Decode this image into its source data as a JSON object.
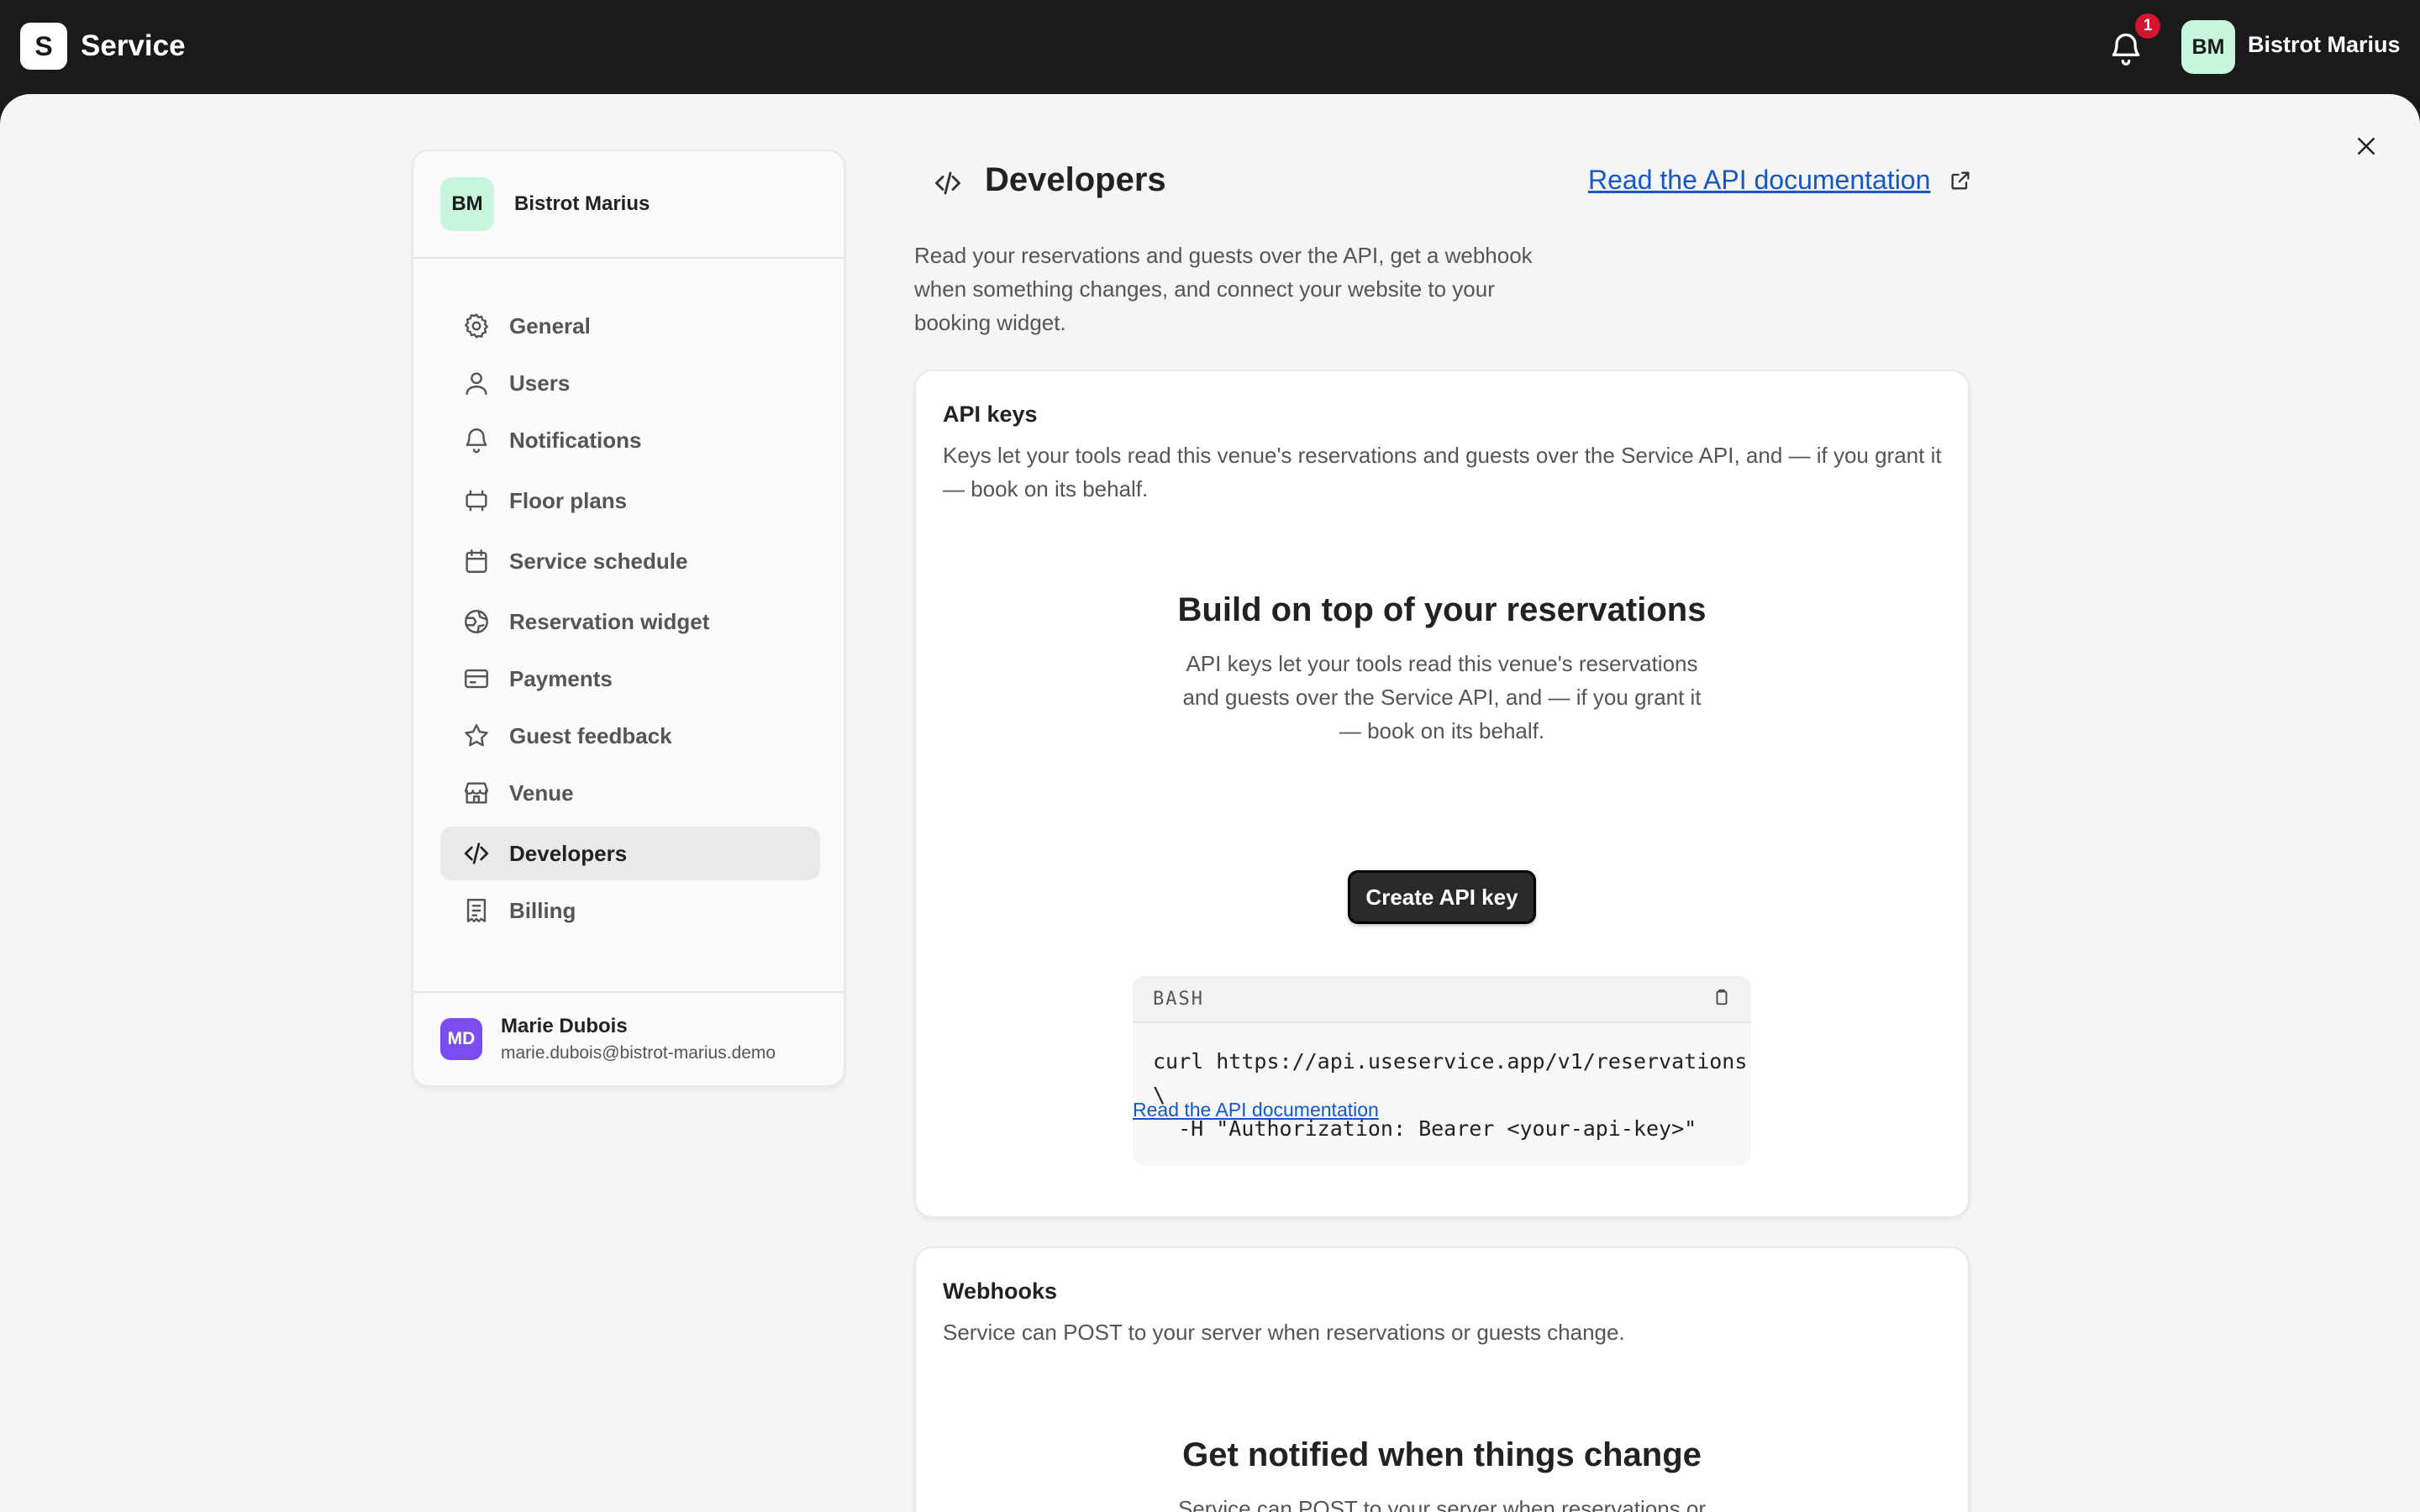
{
  "app": {
    "logo_letter": "S",
    "name": "Service",
    "notification_count": "1",
    "user_initials": "BM",
    "user_name": "Bistrot Marius"
  },
  "sidebar": {
    "venue_initials": "BM",
    "venue_name": "Bistrot Marius",
    "items": [
      {
        "label": "General",
        "icon": "gear-icon"
      },
      {
        "label": "Users",
        "icon": "user-icon"
      },
      {
        "label": "Notifications",
        "icon": "bell-icon"
      },
      {
        "label": "Floor plans",
        "icon": "floor-plan-icon"
      },
      {
        "label": "Service schedule",
        "icon": "calendar-icon"
      },
      {
        "label": "Reservation widget",
        "icon": "globe-icon"
      },
      {
        "label": "Payments",
        "icon": "credit-card-icon"
      },
      {
        "label": "Guest feedback",
        "icon": "star-icon"
      },
      {
        "label": "Venue",
        "icon": "store-icon"
      },
      {
        "label": "Developers",
        "icon": "code-icon",
        "active": true
      },
      {
        "label": "Billing",
        "icon": "receipt-icon"
      }
    ],
    "user": {
      "initials": "MD",
      "name": "Marie Dubois",
      "email": "marie.dubois@bistrot-marius.demo"
    }
  },
  "page": {
    "title": "Developers",
    "docs_link": "Read the API documentation",
    "intro": "Read your reservations and guests over the API, get a webhook when something changes, and connect your website to your booking widget."
  },
  "api_keys": {
    "title": "API keys",
    "description": "Keys let your tools read this venue's reservations and guests over the Service API, and — if you grant it — book on its behalf.",
    "empty_title": "Build on top of your reservations",
    "empty_description": "API keys let your tools read this venue's reservations and guests over the Service API, and — if you grant it — book on its behalf.",
    "create_button": "Create API key",
    "code_language": "BASH",
    "code": "curl https://api.useservice.app/v1/reservations\n\\\n  -H \"Authorization: Bearer <your-api-key>\"",
    "docs_link": "Read the API documentation"
  },
  "webhooks": {
    "title": "Webhooks",
    "description": "Service can POST to your server when reservations or guests change.",
    "empty_title": "Get notified when things change",
    "empty_description": "Service can POST to your server when reservations or"
  }
}
